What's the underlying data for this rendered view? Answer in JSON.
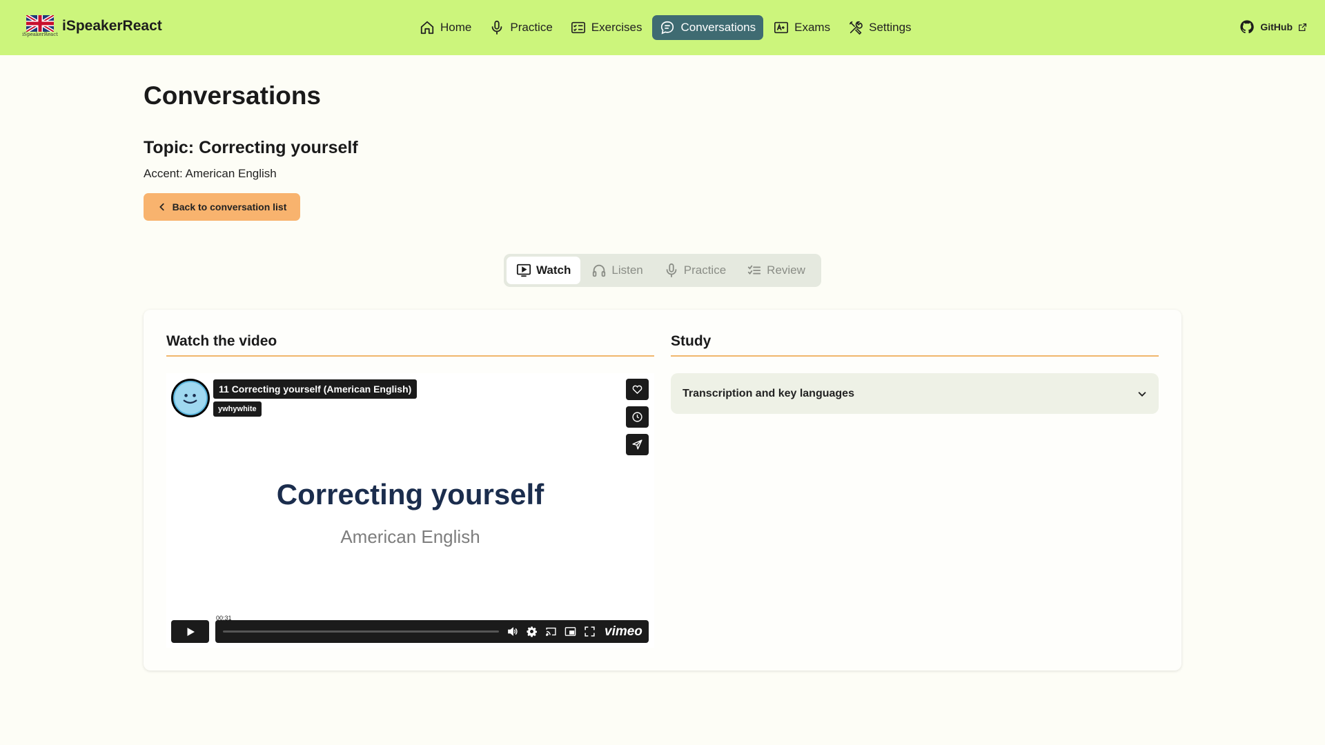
{
  "app": {
    "name": "iSpeakerReact",
    "logo_caption": "iSpeakerReact"
  },
  "nav": {
    "items": [
      {
        "label": "Home",
        "icon": "home-icon"
      },
      {
        "label": "Practice",
        "icon": "microphone-icon"
      },
      {
        "label": "Exercises",
        "icon": "checklist-icon"
      },
      {
        "label": "Conversations",
        "icon": "chat-bubble-icon",
        "active": true
      },
      {
        "label": "Exams",
        "icon": "exam-icon"
      },
      {
        "label": "Settings",
        "icon": "tools-icon"
      }
    ],
    "github_label": "GitHub"
  },
  "page": {
    "title": "Conversations",
    "topic": "Topic: Correcting yourself",
    "accent": "Accent: American English",
    "back_label": "Back to conversation list"
  },
  "tabs": [
    {
      "label": "Watch",
      "icon": "tv-play-icon",
      "active": true
    },
    {
      "label": "Listen",
      "icon": "headphones-icon"
    },
    {
      "label": "Practice",
      "icon": "microphone-icon"
    },
    {
      "label": "Review",
      "icon": "checklist-icon"
    }
  ],
  "watch": {
    "section_title": "Watch the video",
    "video": {
      "title": "11 Correcting yourself (American English)",
      "owner": "ywhywhite",
      "heading": "Correcting yourself",
      "subheading": "American English",
      "time": "00:31",
      "progress": 0.0,
      "brand": "vimeo"
    }
  },
  "study": {
    "section_title": "Study",
    "accordion_label": "Transcription and key languages"
  },
  "colors": {
    "navbar": "#ccf57c",
    "active_nav": "#3f6b72",
    "back_button": "#f8b36e",
    "section_underline": "#f0b66b",
    "video_heading": "#1b2d4d"
  }
}
